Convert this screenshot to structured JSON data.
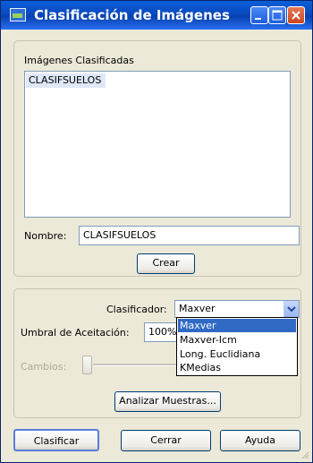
{
  "window": {
    "title": "Clasificación de Imágenes"
  },
  "classified_group": {
    "label": "Imágenes Clasificadas",
    "items": [
      "CLASIFSUELOS"
    ],
    "name_label": "Nombre:",
    "name_value": "CLASIFSUELOS",
    "create_label": "Crear"
  },
  "classifier_group": {
    "classifier_label": "Clasificador:",
    "classifier_value": "Maxver",
    "options": [
      "Maxver",
      "Maxver-Icm",
      "Long. Euclidiana",
      "KMedias"
    ],
    "threshold_label": "Umbral de Aceitación:",
    "threshold_value": "100%",
    "changes_label": "Cambios:",
    "analyze_label": "Analizar Muestras..."
  },
  "footer": {
    "classify_label": "Clasificar",
    "close_label": "Cerrar",
    "help_label": "Ayuda"
  },
  "colors": {
    "titlebar": "#0a4fc9",
    "selection": "#316ac5",
    "panel": "#ece9d8"
  }
}
